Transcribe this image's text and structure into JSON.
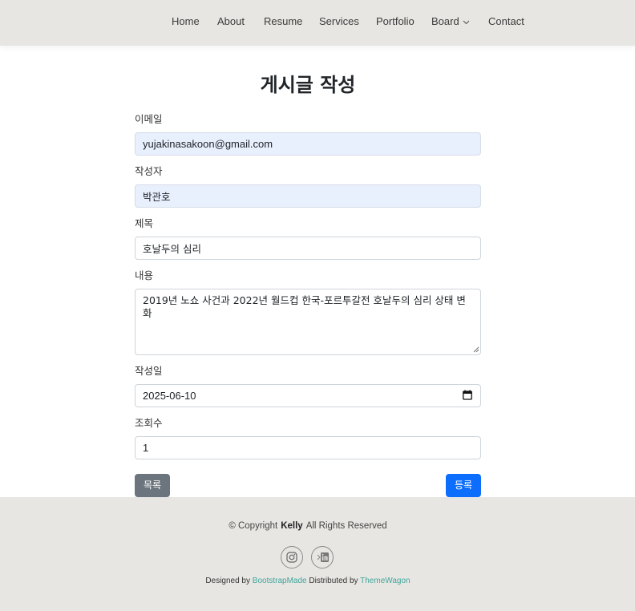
{
  "nav": {
    "items": [
      "Home",
      "About",
      "Resume",
      "Services",
      "Portfolio",
      "Board",
      "Contact"
    ]
  },
  "page": {
    "title": "게시글 작성"
  },
  "form": {
    "email": {
      "label": "이메일",
      "value": "yujakinasakoon@gmail.com"
    },
    "author": {
      "label": "작성자",
      "value": "박관호"
    },
    "subject": {
      "label": "제목",
      "value": "호날두의 심리"
    },
    "content": {
      "label": "내용",
      "value": "2019년 노쇼 사건과 2022년 월드컵 한국-포르투갈전 호날두의 심리 상태 변화"
    },
    "date": {
      "label": "작성일",
      "value": "2025-06-10"
    },
    "views": {
      "label": "조회수",
      "value": "1"
    },
    "list_button": "목록",
    "submit_button": "등록"
  },
  "footer": {
    "copyright_prefix": "© Copyright",
    "copyright_name": "Kelly",
    "copyright_suffix": "All Rights Reserved",
    "designed_by": "Designed by",
    "designer": "BootstrapMade",
    "distributed_by": "Distributed by",
    "distributor": "ThemeWagon",
    "social_icons": [
      "instagram-icon",
      "linkedin-icon"
    ]
  },
  "colors": {
    "nav_bg": "#e8e6e3",
    "primary": "#0d6efd",
    "secondary": "#6c757d",
    "autofill_bg": "#e8f0fe",
    "credit_link": "#3fa59a"
  }
}
